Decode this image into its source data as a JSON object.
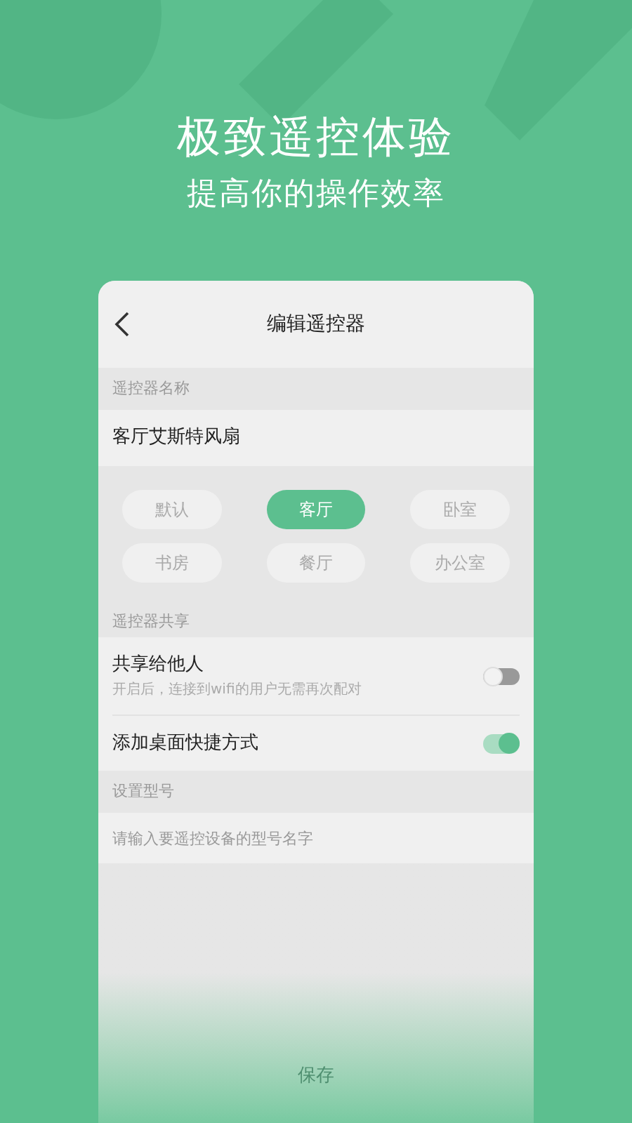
{
  "headline": "极致遥控体验",
  "subheadline": "提高你的操作效率",
  "screen": {
    "title": "编辑遥控器",
    "name_section": {
      "label": "遥控器名称",
      "value": "客厅艾斯特风扇"
    },
    "rooms": [
      {
        "label": "默认",
        "selected": false
      },
      {
        "label": "客厅",
        "selected": true
      },
      {
        "label": "卧室",
        "selected": false
      },
      {
        "label": "书房",
        "selected": false
      },
      {
        "label": "餐厅",
        "selected": false
      },
      {
        "label": "办公室",
        "selected": false
      }
    ],
    "share_section": {
      "label": "遥控器共享",
      "items": [
        {
          "title": "共享给他人",
          "subtitle": "开启后，连接到wifi的用户无需再次配对",
          "on": false
        },
        {
          "title": "添加桌面快捷方式",
          "on": true
        }
      ]
    },
    "model_section": {
      "label": "设置型号",
      "placeholder": "请输入要遥控设备的型号名字"
    },
    "save_button": "保存"
  }
}
